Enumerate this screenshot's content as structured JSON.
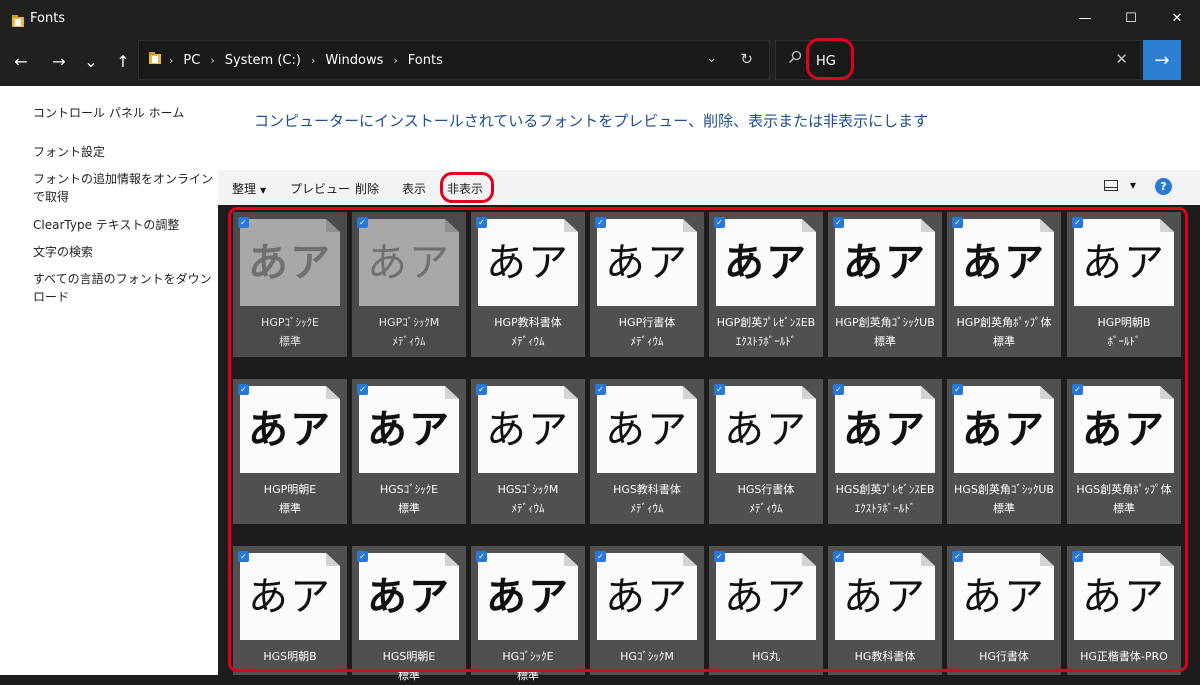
{
  "window": {
    "title": "Fonts"
  },
  "window_controls": {
    "minimize": "—",
    "maximize": "☐",
    "close": "✕"
  },
  "nav": {
    "back": "←",
    "forward": "→",
    "recent": "⌄",
    "up": "↑"
  },
  "address": {
    "breadcrumbs": [
      "PC",
      "System (C:)",
      "Windows",
      "Fonts"
    ],
    "dropdown": "⌄",
    "refresh": "↻"
  },
  "search": {
    "value": "HG",
    "placeholder": "",
    "clear": "✕",
    "go": "→"
  },
  "left_panel": {
    "links": [
      "コントロール パネル ホーム",
      "フォント設定",
      "フォントの追加情報をオンラインで取得",
      "ClearType テキストの調整",
      "文字の検索",
      "すべての言語のフォントをダウンロード"
    ]
  },
  "heading": "コンピューターにインストールされているフォントをプレビュー、削除、表示または非表示にします",
  "toolbar": {
    "organize": "整理",
    "preview": "プレビュー",
    "delete": "削除",
    "show": "表示",
    "hide": "非表示",
    "help": "?"
  },
  "fonts": [
    {
      "name": "HGPｺﾞｼｯｸE 標準",
      "sample": "あア",
      "hidden": true,
      "weight": "bold",
      "family": "sans"
    },
    {
      "name": "HGPｺﾞｼｯｸM ﾒﾃﾞｨｳﾑ",
      "sample": "あア",
      "hidden": true,
      "weight": "normal",
      "family": "sans"
    },
    {
      "name": "HGP教科書体 ﾒﾃﾞｨｳﾑ",
      "sample": "あア",
      "hidden": false,
      "weight": "normal",
      "family": "serif"
    },
    {
      "name": "HGP行書体 ﾒﾃﾞｨｳﾑ",
      "sample": "あア",
      "hidden": false,
      "weight": "normal",
      "family": "serif"
    },
    {
      "name": "HGP創英ﾌﾟﾚｾﾞﾝｽEB ｴｸｽﾄﾗﾎﾞｰﾙﾄﾞ",
      "sample": "あア",
      "hidden": false,
      "weight": "bold",
      "family": "serif"
    },
    {
      "name": "HGP創英角ｺﾞｼｯｸUB 標準",
      "sample": "あア",
      "hidden": false,
      "weight": "bold",
      "family": "sans"
    },
    {
      "name": "HGP創英角ﾎﾟｯﾌﾟ体 標準",
      "sample": "あア",
      "hidden": false,
      "weight": "bold",
      "family": "sans"
    },
    {
      "name": "HGP明朝B ﾎﾞｰﾙﾄﾞ",
      "sample": "あア",
      "hidden": false,
      "weight": "normal",
      "family": "serif"
    },
    {
      "name": "HGP明朝E 標準",
      "sample": "あア",
      "hidden": false,
      "weight": "bold",
      "family": "serif"
    },
    {
      "name": "HGSｺﾞｼｯｸE 標準",
      "sample": "あア",
      "hidden": false,
      "weight": "bold",
      "family": "sans"
    },
    {
      "name": "HGSｺﾞｼｯｸM ﾒﾃﾞｨｳﾑ",
      "sample": "あア",
      "hidden": false,
      "weight": "normal",
      "family": "sans"
    },
    {
      "name": "HGS教科書体 ﾒﾃﾞｨｳﾑ",
      "sample": "あア",
      "hidden": false,
      "weight": "normal",
      "family": "serif"
    },
    {
      "name": "HGS行書体 ﾒﾃﾞｨｳﾑ",
      "sample": "あア",
      "hidden": false,
      "weight": "normal",
      "family": "serif"
    },
    {
      "name": "HGS創英ﾌﾟﾚｾﾞﾝｽEB ｴｸｽﾄﾗﾎﾞｰﾙﾄﾞ",
      "sample": "あア",
      "hidden": false,
      "weight": "bold",
      "family": "serif"
    },
    {
      "name": "HGS創英角ｺﾞｼｯｸUB 標準",
      "sample": "あア",
      "hidden": false,
      "weight": "bold",
      "family": "sans"
    },
    {
      "name": "HGS創英角ﾎﾟｯﾌﾟ体 標準",
      "sample": "あア",
      "hidden": false,
      "weight": "bold",
      "family": "sans"
    },
    {
      "name": "HGS明朝B",
      "sample": "あア",
      "hidden": false,
      "weight": "normal",
      "family": "serif"
    },
    {
      "name": "HGS明朝E 標準",
      "sample": "あア",
      "hidden": false,
      "weight": "bold",
      "family": "serif"
    },
    {
      "name": "HGｺﾞｼｯｸE 標準",
      "sample": "あア",
      "hidden": false,
      "weight": "bold",
      "family": "sans"
    },
    {
      "name": "HGｺﾞｼｯｸM",
      "sample": "あア",
      "hidden": false,
      "weight": "normal",
      "family": "sans"
    },
    {
      "name": "HG丸",
      "sample": "あア",
      "hidden": false,
      "weight": "normal",
      "family": "sans"
    },
    {
      "name": "HG教科書体",
      "sample": "あア",
      "hidden": false,
      "weight": "normal",
      "family": "serif"
    },
    {
      "name": "HG行書体",
      "sample": "あア",
      "hidden": false,
      "weight": "normal",
      "family": "serif"
    },
    {
      "name": "HG正楷書体-PRO",
      "sample": "あア",
      "hidden": false,
      "weight": "normal",
      "family": "serif"
    }
  ],
  "colors": {
    "accent": "#2c7fd2",
    "highlight": "#e0001b",
    "heading": "#1c4f8d"
  }
}
